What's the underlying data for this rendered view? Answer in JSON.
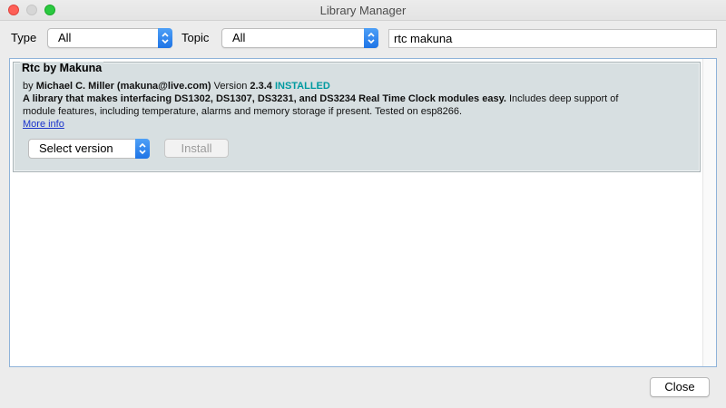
{
  "window": {
    "title": "Library Manager"
  },
  "filters": {
    "type_label": "Type",
    "type_value": "All",
    "topic_label": "Topic",
    "topic_value": "All",
    "search_value": "rtc makuna"
  },
  "library": {
    "name": "Rtc by Makuna",
    "by_prefix": "by ",
    "author": "Michael C. Miller (makuna@live.com)",
    "version_prefix": " Version ",
    "version": "2.3.4",
    "status": "INSTALLED",
    "summary": "A library that makes interfacing DS1302, DS1307, DS3231, and DS3234 Real Time Clock modules easy.",
    "description_part1": " Includes deep support of",
    "description_line2": "module features, including temperature, alarms and memory storage if present. Tested on esp8266.",
    "more_info": "More info",
    "select_version": "Select version",
    "install_label": "Install"
  },
  "footer": {
    "close_label": "Close"
  },
  "colors": {
    "installed": "#009aa0",
    "selected_card": "#d7dfe1",
    "accent": "#1e74e6"
  }
}
